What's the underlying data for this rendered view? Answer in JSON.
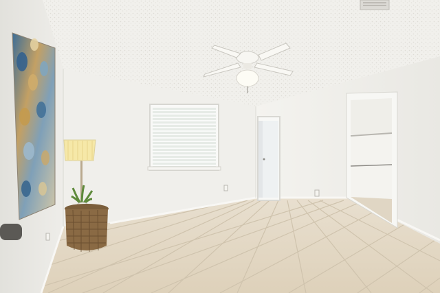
{
  "scene": {
    "kind": "photo",
    "room": "empty bedroom",
    "colors": {
      "ceiling": "#f1f0ec",
      "wall_left": "#e9e8e4",
      "wall_back": "#f0efeb",
      "wall_right": "#f3f2ee",
      "floor": "#e4d9c6",
      "grout": "#cfc3ad",
      "trim": "#f8f7f4",
      "basket": "#8a6a44",
      "artwork_blue": "#3d6d96",
      "artwork_gold": "#c3a064",
      "lamp_shade": "#f6e8a8",
      "plant": "#5f8a3c"
    },
    "icons": {
      "fan": "ceiling-fan-icon",
      "vent": "air-vent-icon"
    }
  }
}
